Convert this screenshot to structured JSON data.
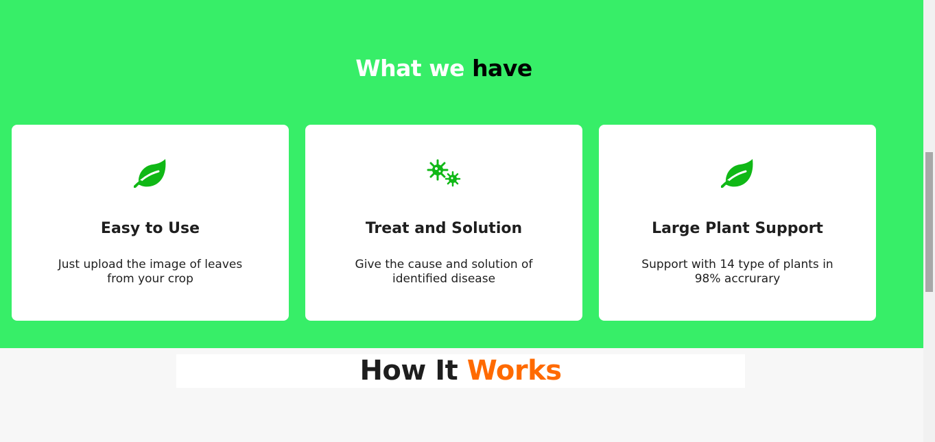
{
  "features": {
    "title_white": "What we",
    "title_dark": "have",
    "cards": [
      {
        "icon": "leaf-icon",
        "title": "Easy to Use",
        "text": "Just upload the image of leaves from your crop"
      },
      {
        "icon": "virus-icon",
        "title": "Treat and Solution",
        "text": "Give the cause and solution of identified disease"
      },
      {
        "icon": "leaf-icon",
        "title": "Large Plant Support",
        "text": "Support with 14 type of plants in 98% accrurary"
      }
    ]
  },
  "how": {
    "dark": "How It",
    "orange": "Works"
  },
  "colors": {
    "section_bg": "#37ee68",
    "icon": "#10b816",
    "accent": "#ff6a00",
    "text": "#1e1e1e"
  }
}
